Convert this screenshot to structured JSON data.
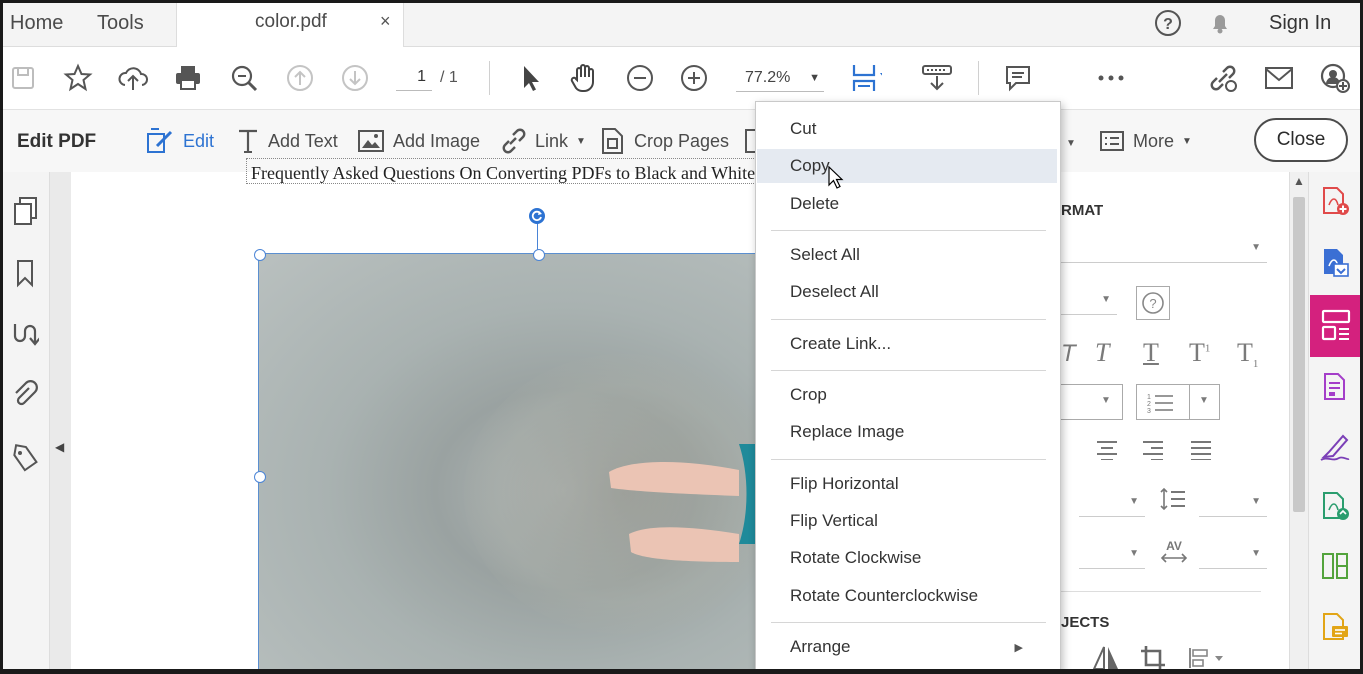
{
  "tabs": {
    "home": "Home",
    "tools": "Tools",
    "document": "color.pdf",
    "close_tab": "×"
  },
  "top_right": {
    "sign_in": "Sign In"
  },
  "toolbar": {
    "page_current": "1",
    "page_total": "/ 1",
    "zoom": "77.2%"
  },
  "editbar": {
    "title": "Edit PDF",
    "items": [
      {
        "label": "Edit"
      },
      {
        "label": "Add Text"
      },
      {
        "label": "Add Image"
      },
      {
        "label": "Link"
      },
      {
        "label": "Crop Pages"
      },
      {
        "label": "More"
      }
    ],
    "close": "Close"
  },
  "document": {
    "headline": "Frequently Asked Questions On Converting PDFs to Black and White C"
  },
  "format_panel": {
    "format_heading": "RMAT",
    "objects_heading": "JECTS"
  },
  "context_menu": [
    {
      "label": "Cut"
    },
    {
      "label": "Copy"
    },
    {
      "label": "Delete"
    },
    {
      "label": "Select All"
    },
    {
      "label": "Deselect All"
    },
    {
      "label": "Create Link..."
    },
    {
      "label": "Crop"
    },
    {
      "label": "Replace Image"
    },
    {
      "label": "Flip Horizontal"
    },
    {
      "label": "Flip Vertical"
    },
    {
      "label": "Rotate Clockwise"
    },
    {
      "label": "Rotate Counterclockwise"
    },
    {
      "label": "Arrange"
    }
  ],
  "colors": {
    "accent_blue": "#2d73d2",
    "rail_selected": "#d4217e",
    "text": "#333333"
  }
}
